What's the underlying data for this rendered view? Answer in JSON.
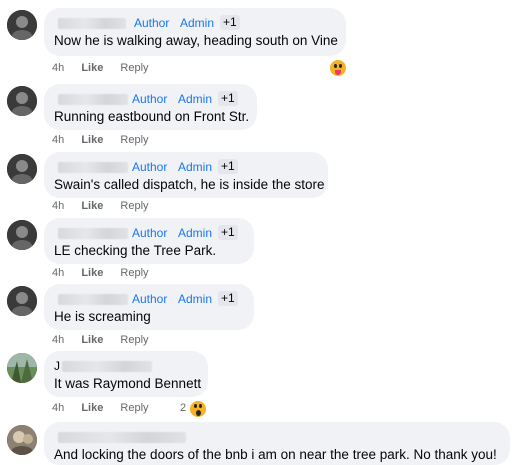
{
  "badges": {
    "author": "Author",
    "admin": "Admin",
    "plus": "+1"
  },
  "actions": {
    "time": "4h",
    "like": "Like",
    "reply": "Reply"
  },
  "comments": [
    {
      "initial": "",
      "text": "Now he is walking away, heading south on Vine",
      "reaction": "laugh-tongue"
    },
    {
      "initial": "",
      "text": "Running eastbound on Front Str."
    },
    {
      "initial": "",
      "text": "Swain's called dispatch, he is inside the store"
    },
    {
      "initial": "",
      "text": "LE checking the Tree Park."
    },
    {
      "initial": "",
      "text": "He is screaming"
    },
    {
      "initial": "J",
      "text": "It was Raymond Bennett",
      "reaction": "wow",
      "reaction_count": "2"
    },
    {
      "initial": "",
      "text": "And locking the doors of the bnb i am on near the tree park. No thank you!"
    }
  ],
  "colors": {
    "bubble": "#f0f2f5",
    "badge": "#1877f2",
    "meta": "#65676b"
  }
}
